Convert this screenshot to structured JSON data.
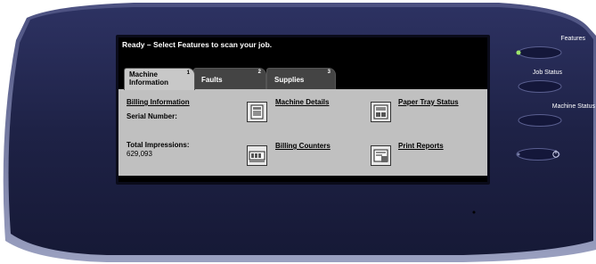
{
  "status_message": "Ready – Select Features to scan your job.",
  "tabs": [
    {
      "label": "Machine Information",
      "number": "1"
    },
    {
      "label": "Faults",
      "number": "2"
    },
    {
      "label": "Supplies",
      "number": "3"
    }
  ],
  "machine_info": {
    "billing_information": "Billing Information",
    "serial_number_label": "Serial Number:",
    "total_impressions_label": "Total Impressions:",
    "total_impressions_value": "629,093",
    "machine_details": "Machine Details",
    "billing_counters": "Billing Counters",
    "paper_tray_status": "Paper Tray Status",
    "print_reports": "Print Reports"
  },
  "hard_buttons": {
    "features": "Features",
    "job_status": "Job Status",
    "machine_status": "Machine Status"
  },
  "icons": {
    "machine_details": "printer-icon",
    "billing_counters": "counter-icon",
    "paper_tray_status": "paper-tray-icon",
    "print_reports": "report-icon",
    "power_saver": "power-icon"
  },
  "colors": {
    "bezel": "#1f2348",
    "screen_content": "#c0c0c0",
    "indicator_led": "#9ee86b"
  }
}
